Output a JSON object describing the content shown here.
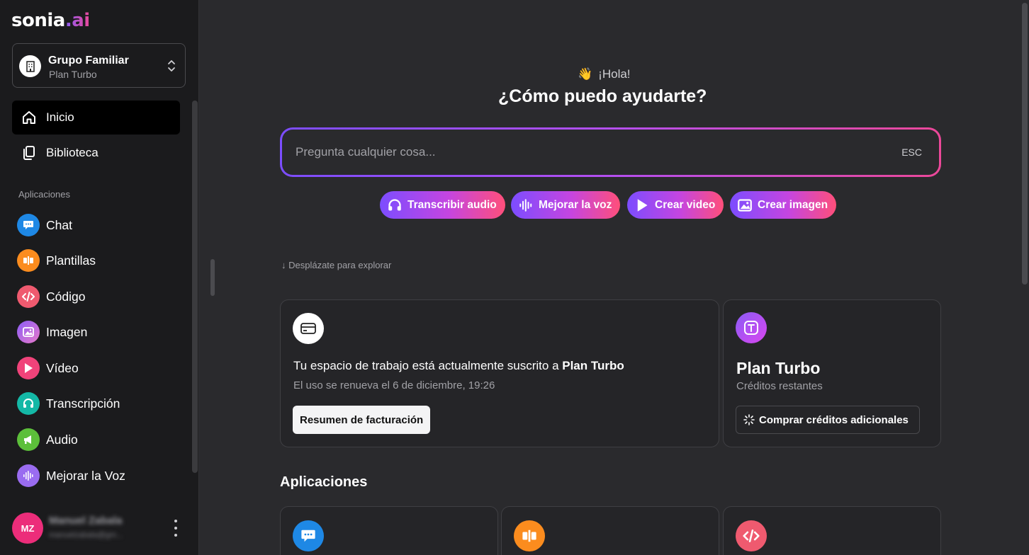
{
  "brand": {
    "name": "sonia",
    "suffix": ".ai"
  },
  "workspace": {
    "name": "Grupo Familiar",
    "plan": "Plan Turbo"
  },
  "nav": [
    {
      "label": "Inicio",
      "icon": "home-icon",
      "active": true
    },
    {
      "label": "Biblioteca",
      "icon": "library-icon",
      "active": false
    }
  ],
  "sidebar_section_label": "Aplicaciones",
  "apps": [
    {
      "label": "Chat",
      "icon": "chat-icon",
      "color": "#1e88e5"
    },
    {
      "label": "Plantillas",
      "icon": "templates-icon",
      "color": "#fb8c1e"
    },
    {
      "label": "Código",
      "icon": "code-icon",
      "color": "#ef5a6f"
    },
    {
      "label": "Imagen",
      "icon": "image-icon",
      "color": "#b07cf0"
    },
    {
      "label": "Vídeo",
      "icon": "video-icon",
      "color": "#f0437a"
    },
    {
      "label": "Transcripción",
      "icon": "headphones-icon",
      "color": "#14b8a6"
    },
    {
      "label": "Audio",
      "icon": "megaphone-icon",
      "color": "#5cbf3a"
    },
    {
      "label": "Mejorar la Voz",
      "icon": "waveform-icon",
      "color": "#9a6cf0"
    }
  ],
  "user": {
    "initials": "MZ",
    "name": "Manuel Zabala",
    "email": "manuelzabala@gm..."
  },
  "main": {
    "greeting": "¡Hola!",
    "greeting_emoji": "👋",
    "title": "¿Cómo puedo ayudarte?",
    "ask_placeholder": "Pregunta cualquier cosa...",
    "esc_hint": "ESC",
    "chips": [
      {
        "label": "Transcribir audio",
        "icon": "headphones-icon"
      },
      {
        "label": "Mejorar la voz",
        "icon": "waveform-icon"
      },
      {
        "label": "Crear video",
        "icon": "play-icon"
      },
      {
        "label": "Crear imagen",
        "icon": "image-icon"
      }
    ],
    "explore_hint": "↓  Desplázate para explorar",
    "subscription": {
      "text_prefix": "Tu espacio de trabajo está actualmente suscrito a ",
      "plan": "Plan Turbo",
      "renewal": "El uso se renueva el 6 de diciembre, 19:26",
      "billing_button": "Resumen de facturación"
    },
    "plan_card": {
      "name": "Plan Turbo",
      "credits_label": "Créditos restantes",
      "buy_button": "Comprar créditos adicionales"
    },
    "apps_heading": "Aplicaciones"
  },
  "colors": {
    "accent_start": "#7c4dff",
    "accent_end": "#ec4899",
    "sidebar_bg": "#1b1b1d",
    "main_bg": "#2a2a2d"
  }
}
